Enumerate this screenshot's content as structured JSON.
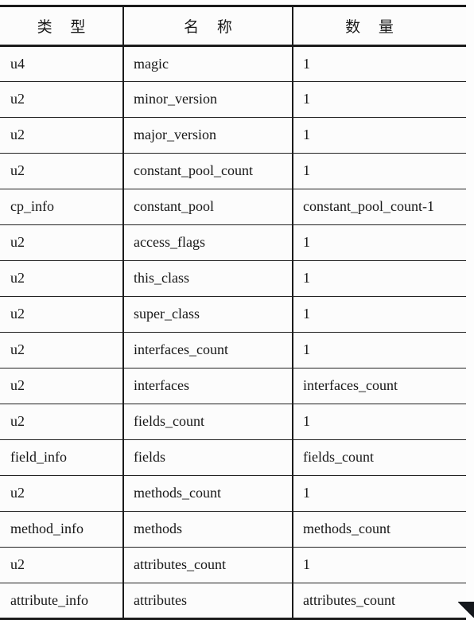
{
  "table": {
    "columns": [
      {
        "key": "type",
        "label": "类 型"
      },
      {
        "key": "name",
        "label": "名 称"
      },
      {
        "key": "quantity",
        "label": "数 量"
      }
    ],
    "rows": [
      {
        "type": "u4",
        "name": "magic",
        "quantity": "1"
      },
      {
        "type": "u2",
        "name": "minor_version",
        "quantity": "1"
      },
      {
        "type": "u2",
        "name": "major_version",
        "quantity": "1"
      },
      {
        "type": "u2",
        "name": "constant_pool_count",
        "quantity": "1"
      },
      {
        "type": "cp_info",
        "name": "constant_pool",
        "quantity": "constant_pool_count-1"
      },
      {
        "type": "u2",
        "name": "access_flags",
        "quantity": "1"
      },
      {
        "type": "u2",
        "name": "this_class",
        "quantity": "1"
      },
      {
        "type": "u2",
        "name": "super_class",
        "quantity": "1"
      },
      {
        "type": "u2",
        "name": "interfaces_count",
        "quantity": "1"
      },
      {
        "type": "u2",
        "name": "interfaces",
        "quantity": "interfaces_count"
      },
      {
        "type": "u2",
        "name": "fields_count",
        "quantity": "1"
      },
      {
        "type": "field_info",
        "name": "fields",
        "quantity": "fields_count"
      },
      {
        "type": "u2",
        "name": "methods_count",
        "quantity": "1"
      },
      {
        "type": "method_info",
        "name": "methods",
        "quantity": "methods_count"
      },
      {
        "type": "u2",
        "name": "attributes_count",
        "quantity": "1"
      },
      {
        "type": "attribute_info",
        "name": "attributes",
        "quantity": "attributes_count"
      }
    ]
  },
  "colors": {
    "rule": "#1b1b1b",
    "text": "#171717",
    "page": "#fcfcfc"
  }
}
